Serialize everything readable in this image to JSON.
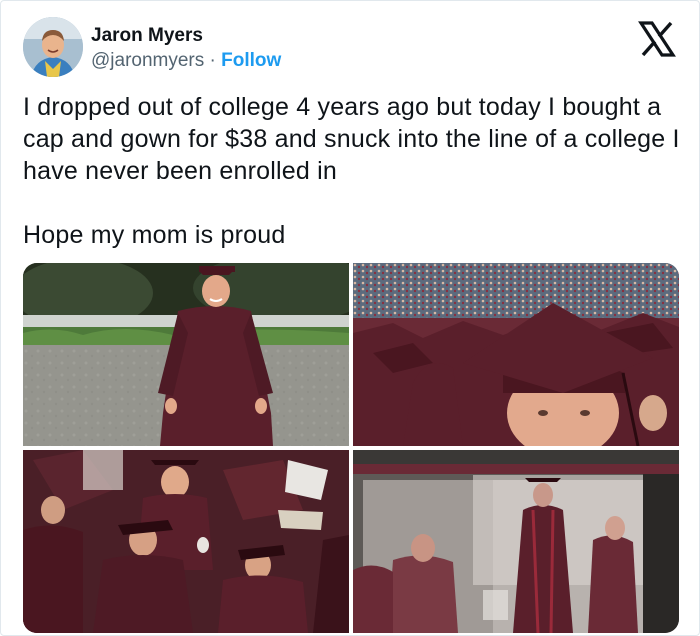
{
  "author": {
    "name": "Jaron Myers",
    "handle": "@jaronmyers",
    "separator": "·",
    "follow_label": "Follow",
    "avatar_icon": "profile-photo"
  },
  "platform": {
    "logo_icon": "x-logo-icon"
  },
  "tweet": {
    "paragraphs": [
      "I dropped out of college 4 years ago but today I bought a cap and gown for $38 and snuck into the line of a college I have never been enrolled in",
      "Hope my mom is proud"
    ]
  },
  "media": {
    "count": 4,
    "photos": [
      {
        "name": "photo-posing-cap-gown",
        "description_icon": "graduate-photo"
      },
      {
        "name": "photo-crowd-selfie",
        "description_icon": "crowd-photo"
      },
      {
        "name": "photo-ceremony-lineup",
        "description_icon": "ceremony-photo"
      },
      {
        "name": "photo-jumbotron",
        "description_icon": "screen-photo"
      }
    ]
  },
  "colors": {
    "maroon": "#5a1f2b",
    "link_blue": "#1d9bf0",
    "text": "#0f1419",
    "muted": "#536471"
  }
}
